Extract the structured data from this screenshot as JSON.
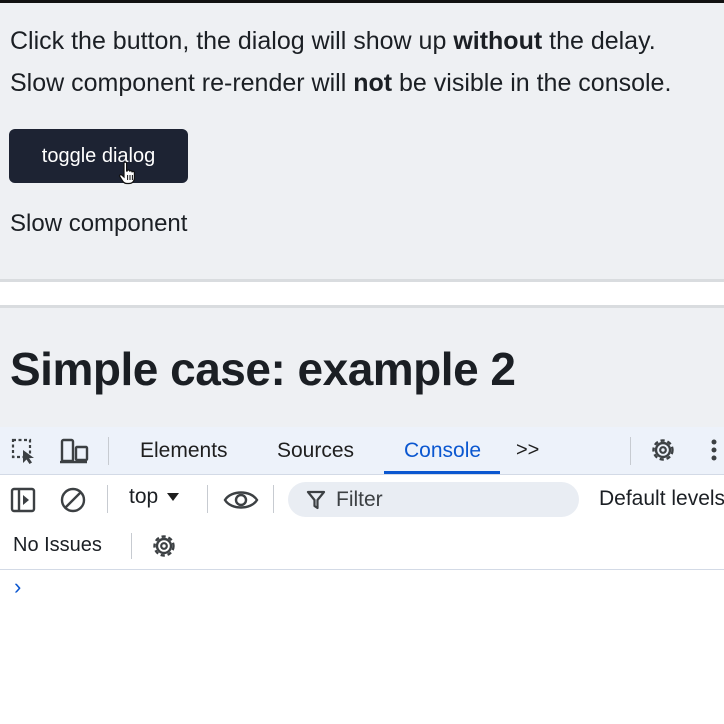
{
  "page": {
    "line1": {
      "pre": "Click the button, the dialog will show up ",
      "bold": "without",
      "post": " the delay."
    },
    "line2": {
      "pre": "Slow component re-render will ",
      "bold": "not",
      "post": " be visible in the console."
    },
    "toggle_button": "toggle dialog",
    "slow_component": "Slow component",
    "heading2": "Simple case: example 2"
  },
  "devtools": {
    "tabs": [
      "Elements",
      "Sources",
      "Console"
    ],
    "active_tab": "Console",
    "more_tabs": ">>",
    "context": "top",
    "filter_placeholder": "Filter",
    "levels": "Default levels",
    "issues": "No Issues",
    "prompt": "›"
  },
  "colors": {
    "accent": "#0b57d0",
    "button_bg": "#1d2333",
    "page_bg": "#eef0f3"
  }
}
